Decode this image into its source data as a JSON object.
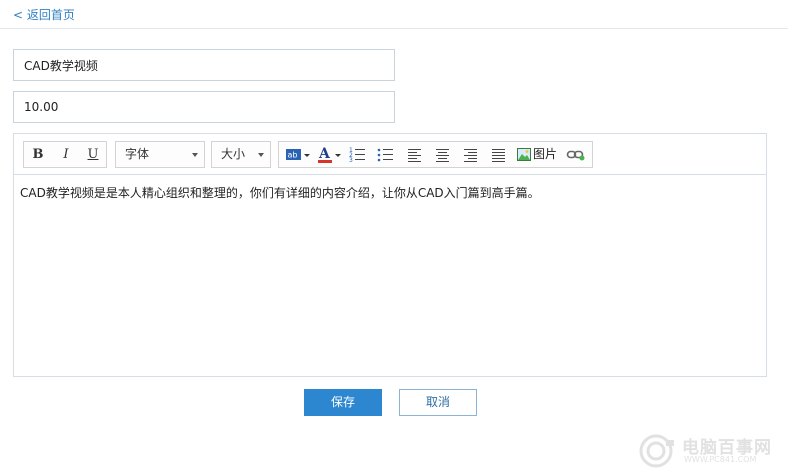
{
  "header": {
    "back_label": "< 返回首页"
  },
  "form": {
    "title_value": "CAD教学视频",
    "price_value": "10.00"
  },
  "toolbar": {
    "bold": "B",
    "italic": "I",
    "underline": "U",
    "font_select": "字体",
    "size_select": "大小",
    "image_label": "图片"
  },
  "editor": {
    "content": "CAD教学视频是是本人精心组织和整理的，你们有详细的内容介绍，让你从CAD入门篇到高手篇。"
  },
  "actions": {
    "save_label": "保存",
    "cancel_label": "取消"
  },
  "watermark": {
    "text": "电脑百事网",
    "sub": "WWW.PC841.COM"
  },
  "colors": {
    "accent": "#2c87d0",
    "link": "#2f7fc1",
    "font_color_bar": "#d9342b"
  }
}
